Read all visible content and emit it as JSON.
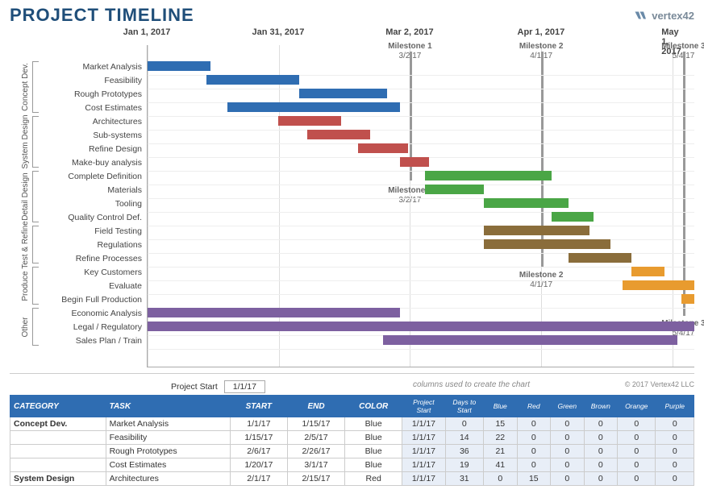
{
  "title": "PROJECT TIMELINE",
  "logo": "vertex42",
  "x_ticks": [
    "Jan 1, 2017",
    "Jan 31, 2017",
    "Mar 2, 2017",
    "Apr 1, 2017",
    "May 1, 2017"
  ],
  "milestones": [
    {
      "name": "Milestone 1",
      "date": "3/2/17"
    },
    {
      "name": "Milestone 2",
      "date": "4/1/17"
    },
    {
      "name": "Milestone 3",
      "date": "5/4/17"
    }
  ],
  "milestone_repeats": [
    {
      "name": "Milestone 1",
      "date": "3/2/17"
    },
    {
      "name": "Milestone 2",
      "date": "4/1/17"
    },
    {
      "name": "Milestone 3",
      "date": "5/4/17"
    }
  ],
  "categories": [
    {
      "name": "Concept Dev.",
      "tasks": [
        "Market Analysis",
        "Feasibility",
        "Rough Prototypes",
        "Cost Estimates"
      ]
    },
    {
      "name": "System Design",
      "tasks": [
        "Architectures",
        "Sub-systems",
        "Refine Design",
        "Make-buy analysis"
      ]
    },
    {
      "name": "Detail Design",
      "tasks": [
        "Complete Definition",
        "Materials",
        "Tooling",
        "Quality Control Def."
      ]
    },
    {
      "name": "Test & Refine",
      "tasks": [
        "Field Testing",
        "Regulations",
        "Refine Processes"
      ]
    },
    {
      "name": "Produce",
      "tasks": [
        "Key Customers",
        "Evaluate",
        "Begin Full Production"
      ]
    },
    {
      "name": "Other",
      "tasks": [
        "Economic Analysis",
        "Legal / Regulatory",
        "Sales Plan / Train"
      ]
    }
  ],
  "project_start_label": "Project Start",
  "project_start_value": "1/1/17",
  "columns_note": "columns used to create the chart",
  "copyright": "© 2017 Vertex42 LLC",
  "table": {
    "headers": [
      "CATEGORY",
      "TASK",
      "START",
      "END",
      "COLOR"
    ],
    "hint_headers": [
      "Project Start",
      "Days to Start",
      "Blue",
      "Red",
      "Green",
      "Brown",
      "Orange",
      "Purple"
    ],
    "rows": [
      {
        "cat": "Concept Dev.",
        "task": "Market Analysis",
        "start": "1/1/17",
        "end": "1/15/17",
        "color": "Blue",
        "ps": "1/1/17",
        "dts": "0",
        "blue": "15",
        "red": "0",
        "green": "0",
        "brown": "0",
        "orange": "0",
        "purple": "0"
      },
      {
        "cat": "",
        "task": "Feasibility",
        "start": "1/15/17",
        "end": "2/5/17",
        "color": "Blue",
        "ps": "1/1/17",
        "dts": "14",
        "blue": "22",
        "red": "0",
        "green": "0",
        "brown": "0",
        "orange": "0",
        "purple": "0"
      },
      {
        "cat": "",
        "task": "Rough Prototypes",
        "start": "2/6/17",
        "end": "2/26/17",
        "color": "Blue",
        "ps": "1/1/17",
        "dts": "36",
        "blue": "21",
        "red": "0",
        "green": "0",
        "brown": "0",
        "orange": "0",
        "purple": "0"
      },
      {
        "cat": "",
        "task": "Cost Estimates",
        "start": "1/20/17",
        "end": "3/1/17",
        "color": "Blue",
        "ps": "1/1/17",
        "dts": "19",
        "blue": "41",
        "red": "0",
        "green": "0",
        "brown": "0",
        "orange": "0",
        "purple": "0"
      },
      {
        "cat": "System Design",
        "task": "Architectures",
        "start": "2/1/17",
        "end": "2/15/17",
        "color": "Red",
        "ps": "1/1/17",
        "dts": "31",
        "blue": "0",
        "red": "15",
        "green": "0",
        "brown": "0",
        "orange": "0",
        "purple": "0"
      }
    ]
  },
  "chart_data": {
    "type": "bar",
    "title": "PROJECT TIMELINE",
    "xlabel": "",
    "ylabel": "",
    "x_axis_dates": [
      "Jan 1, 2017",
      "Jan 31, 2017",
      "Mar 2, 2017",
      "Apr 1, 2017",
      "May 1, 2017"
    ],
    "x_range_days": [
      0,
      130
    ],
    "series": [
      {
        "group": "Concept Dev.",
        "task": "Market Analysis",
        "start_day": 0,
        "duration": 15,
        "color": "blue"
      },
      {
        "group": "Concept Dev.",
        "task": "Feasibility",
        "start_day": 14,
        "duration": 22,
        "color": "blue"
      },
      {
        "group": "Concept Dev.",
        "task": "Rough Prototypes",
        "start_day": 36,
        "duration": 21,
        "color": "blue"
      },
      {
        "group": "Concept Dev.",
        "task": "Cost Estimates",
        "start_day": 19,
        "duration": 41,
        "color": "blue"
      },
      {
        "group": "System Design",
        "task": "Architectures",
        "start_day": 31,
        "duration": 15,
        "color": "red"
      },
      {
        "group": "System Design",
        "task": "Sub-systems",
        "start_day": 38,
        "duration": 15,
        "color": "red"
      },
      {
        "group": "System Design",
        "task": "Refine Design",
        "start_day": 50,
        "duration": 12,
        "color": "red"
      },
      {
        "group": "System Design",
        "task": "Make-buy analysis",
        "start_day": 60,
        "duration": 7,
        "color": "red"
      },
      {
        "group": "Detail Design",
        "task": "Complete Definition",
        "start_day": 66,
        "duration": 30,
        "color": "green"
      },
      {
        "group": "Detail Design",
        "task": "Materials",
        "start_day": 66,
        "duration": 14,
        "color": "green"
      },
      {
        "group": "Detail Design",
        "task": "Tooling",
        "start_day": 80,
        "duration": 20,
        "color": "green"
      },
      {
        "group": "Detail Design",
        "task": "Quality Control Def.",
        "start_day": 96,
        "duration": 10,
        "color": "green"
      },
      {
        "group": "Test & Refine",
        "task": "Field Testing",
        "start_day": 80,
        "duration": 25,
        "color": "brown"
      },
      {
        "group": "Test & Refine",
        "task": "Regulations",
        "start_day": 80,
        "duration": 30,
        "color": "brown"
      },
      {
        "group": "Test & Refine",
        "task": "Refine Processes",
        "start_day": 100,
        "duration": 15,
        "color": "brown"
      },
      {
        "group": "Produce",
        "task": "Key Customers",
        "start_day": 115,
        "duration": 8,
        "color": "orange"
      },
      {
        "group": "Produce",
        "task": "Evaluate",
        "start_day": 113,
        "duration": 17,
        "color": "orange"
      },
      {
        "group": "Produce",
        "task": "Begin Full Production",
        "start_day": 127,
        "duration": 3,
        "color": "orange"
      },
      {
        "group": "Other",
        "task": "Economic Analysis",
        "start_day": 0,
        "duration": 60,
        "color": "purple"
      },
      {
        "group": "Other",
        "task": "Legal / Regulatory",
        "start_day": 0,
        "duration": 130,
        "color": "purple"
      },
      {
        "group": "Other",
        "task": "Sales Plan / Train",
        "start_day": 56,
        "duration": 70,
        "color": "purple"
      }
    ],
    "milestones": [
      {
        "name": "Milestone 1",
        "date": "3/2/17",
        "day": 60
      },
      {
        "name": "Milestone 2",
        "date": "4/1/17",
        "day": 90
      },
      {
        "name": "Milestone 3",
        "date": "5/4/17",
        "day": 123
      }
    ]
  }
}
